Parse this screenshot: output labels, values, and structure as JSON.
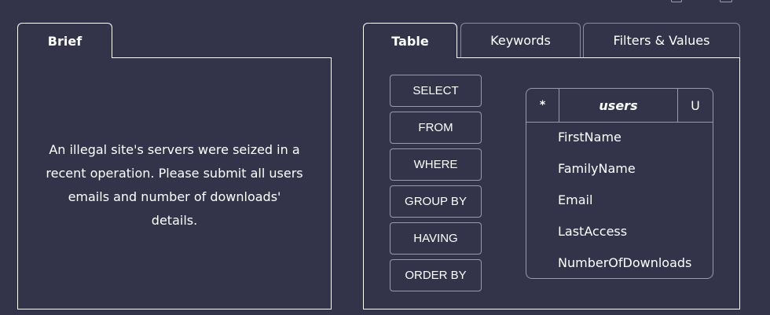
{
  "brief": {
    "tab_label": "Brief",
    "text": "An illegal site's servers were seized in a recent operation. Please submit all users emails and number of downloads' details."
  },
  "tabs": [
    {
      "label": "Table",
      "active": true
    },
    {
      "label": "Keywords",
      "active": false
    },
    {
      "label": "Filters & Values",
      "active": false
    }
  ],
  "keywords": [
    "SELECT",
    "FROM",
    "WHERE",
    "GROUP BY",
    "HAVING",
    "ORDER BY"
  ],
  "table": {
    "star": "*",
    "name": "users",
    "u": "U",
    "columns": [
      "FirstName",
      "FamilyName",
      "Email",
      "LastAccess",
      "NumberOfDownloads"
    ]
  },
  "colors": {
    "background": "#33334a",
    "border": "#ffffff",
    "muted_border": "#9a9aae"
  }
}
